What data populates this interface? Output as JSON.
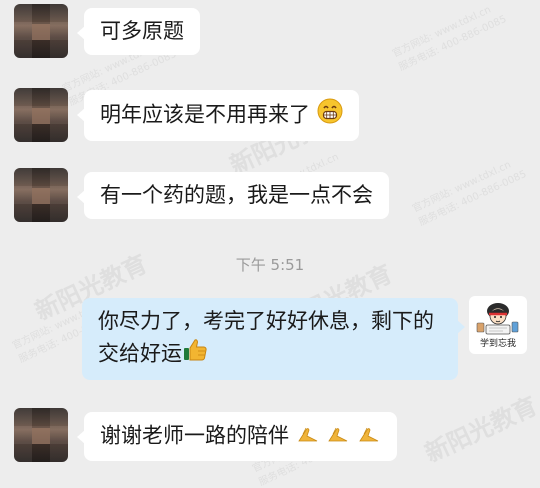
{
  "messages": [
    {
      "sender": "student",
      "text": "可多原题"
    },
    {
      "sender": "student",
      "text": "明年应该是不用再来了",
      "emoji": "grinning-face"
    },
    {
      "sender": "student",
      "text": "有一个药的题，我是一点不会"
    },
    {
      "sender": "teacher",
      "text": "你尽力了，考完了好好休息，剩下的交给好运",
      "emoji": "thumbs-up"
    },
    {
      "sender": "student",
      "text": "谢谢老师一路的陪伴",
      "emoji": "folded-hands"
    }
  ],
  "timestamp": "下午 5:51",
  "teacher_avatar": {
    "label": "学到忘我"
  },
  "watermark": {
    "brand": "新阳光教育",
    "website": "官方网站: www.tdxl.cn",
    "phone": "服务电话: 400-886-0085"
  },
  "colors": {
    "background": "#ededed",
    "bubble_incoming": "#ffffff",
    "bubble_outgoing": "#d6ecfb",
    "timestamp_text": "#9a9a9a"
  }
}
